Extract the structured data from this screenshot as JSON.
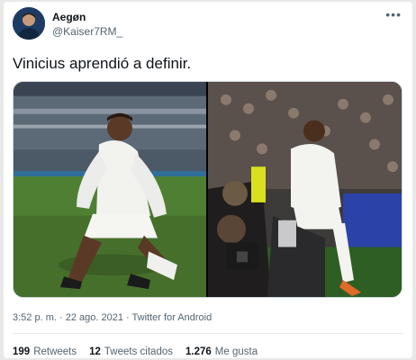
{
  "author": {
    "display_name": "Aegøn",
    "handle": "@Kaiser7RM_"
  },
  "tweet": {
    "text": "Vinicius aprendió a definir."
  },
  "meta": {
    "time": "3:52 p. m.",
    "date": "22 ago. 2021",
    "source": "Twitter for Android",
    "separator": "·"
  },
  "stats": {
    "retweets_count": "199",
    "retweets_label": "Retweets",
    "quotes_count": "12",
    "quotes_label": "Tweets citados",
    "likes_count": "1.276",
    "likes_label": "Me gusta"
  },
  "icons": {
    "more": "more-horizontal-icon"
  }
}
